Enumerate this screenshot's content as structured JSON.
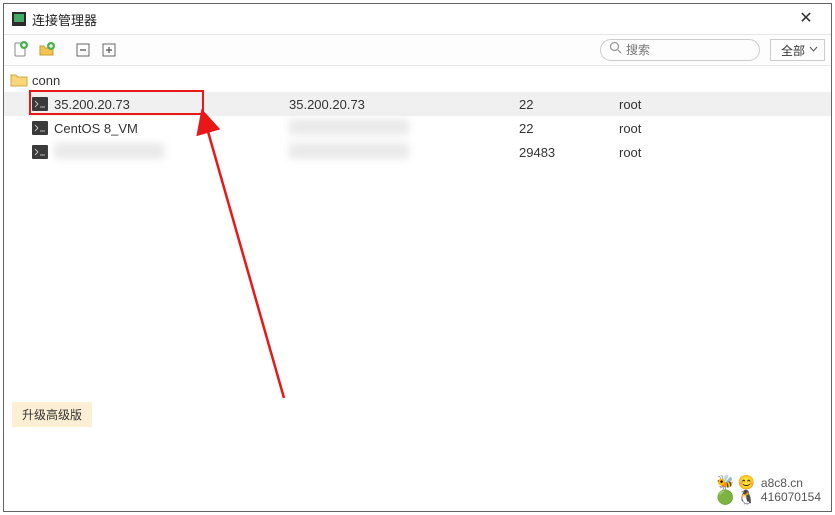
{
  "window": {
    "title": "连接管理器"
  },
  "toolbar": {
    "search_placeholder": "搜索",
    "filter_label": "全部"
  },
  "tree": {
    "folder": "conn",
    "connections": [
      {
        "name": "35.200.20.73",
        "host": "35.200.20.73",
        "port": "22",
        "user": "root",
        "highlighted": true,
        "selected": true
      },
      {
        "name": "CentOS 8_VM",
        "host": "",
        "port": "22",
        "user": "root",
        "host_blurred": true
      },
      {
        "name": "",
        "host": "",
        "port": "29483",
        "user": "root",
        "name_blurred": true,
        "host_blurred": true
      }
    ]
  },
  "footer": {
    "upgrade_label": "升级高级版",
    "watermark_site": "a8c8.cn",
    "watermark_qq": "416070154"
  }
}
